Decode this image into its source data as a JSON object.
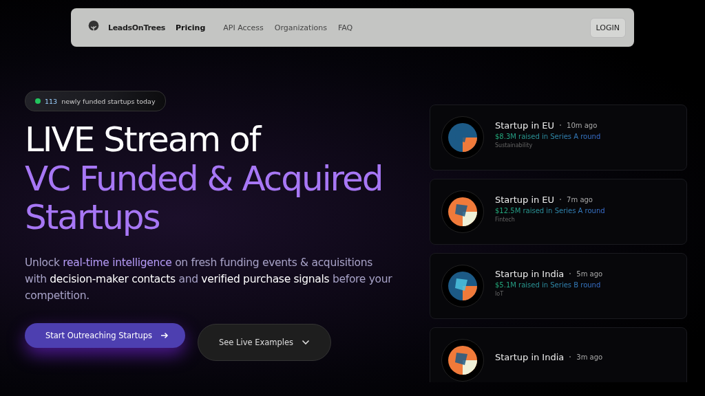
{
  "nav": {
    "brand": "LeadsOnTrees",
    "links": [
      {
        "label": "Pricing",
        "selected": true
      },
      {
        "label": "API Access",
        "selected": false
      },
      {
        "label": "Organizations",
        "selected": false
      },
      {
        "label": "FAQ",
        "selected": false
      }
    ],
    "login": "LOGIN"
  },
  "badge": {
    "count": "113",
    "text": "newly funded startups today",
    "color": "#22c55e"
  },
  "headline": {
    "line1": "LIVE Stream of",
    "line2": "VC Funded & Acquired Startups"
  },
  "description": "Unlock *real-time intelligence* on fresh funding events & acquisitions with **decision-maker contacts** and **verified purchase signals** before your competition.",
  "buttons": {
    "primary": "Start Outreaching Startups",
    "secondary": "See Live Examples"
  },
  "feed": [
    {
      "title": "Startup in EU",
      "time": "10m ago",
      "raise": "$8.3M raised in Series A round",
      "sector": "Sustainability"
    },
    {
      "title": "Startup in EU",
      "time": "7m ago",
      "raise": "$12.5M raised in Series A round",
      "sector": "Fintech"
    },
    {
      "title": "Startup in India",
      "time": "5m ago",
      "raise": "$5.1M raised in Series B round",
      "sector": "IoT"
    },
    {
      "title": "Startup in India",
      "time": "3m ago"
    }
  ]
}
